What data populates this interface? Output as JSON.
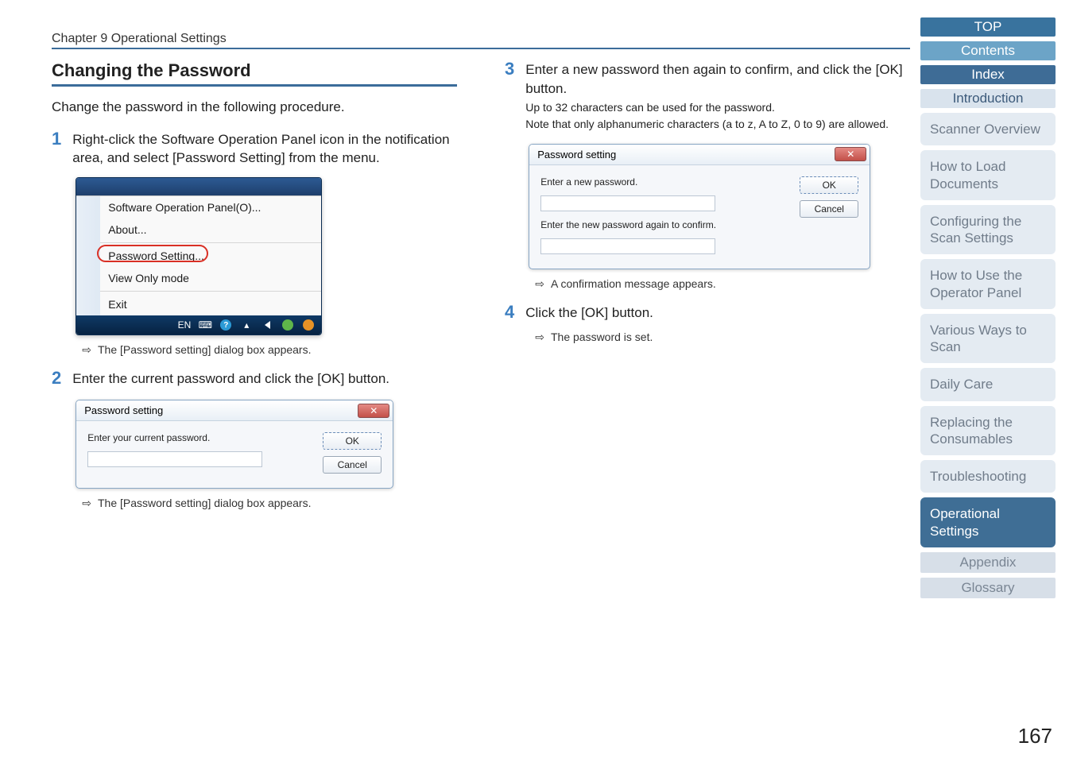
{
  "chapter": "Chapter 9 Operational Settings",
  "page_number": "167",
  "section_title": "Changing the Password",
  "intro_sentence": "Change the password in the following procedure.",
  "steps": [
    {
      "num": "1",
      "text": "Right-click the Software Operation Panel icon in the notification area, and select [Password Setting] from the menu.",
      "result": "The [Password setting] dialog box appears."
    },
    {
      "num": "2",
      "text": "Enter the current password and click the [OK] button.",
      "result": "The [Password setting] dialog box appears."
    },
    {
      "num": "3",
      "text": "Enter a new password then again to confirm, and click the [OK] button.",
      "note1": "Up to 32 characters can be used for the password.",
      "note2": "Note that only alphanumeric characters (a to z, A to Z, 0 to 9) are allowed.",
      "result": "A confirmation message appears."
    },
    {
      "num": "4",
      "text": "Click the [OK] button.",
      "result": "The password is set."
    }
  ],
  "menu": {
    "items": [
      "Software Operation Panel(O)...",
      "About..."
    ],
    "circled": "Password Setting...",
    "after_circled": "View Only mode",
    "exit": "Exit",
    "lang": "EN"
  },
  "dialog1": {
    "title": "Password setting",
    "label": "Enter your current password.",
    "ok": "OK",
    "cancel": "Cancel"
  },
  "dialog2": {
    "title": "Password setting",
    "label1": "Enter a new password.",
    "label2": "Enter the new password again to confirm.",
    "ok": "OK",
    "cancel": "Cancel"
  },
  "sidebar": {
    "top": "TOP",
    "contents": "Contents",
    "index": "Index",
    "intro": "Introduction",
    "items": [
      "Scanner Overview",
      "How to Load Documents",
      "Configuring the Scan Settings",
      "How to Use the Operator Panel",
      "Various Ways to Scan",
      "Daily Care",
      "Replacing the Consumables",
      "Troubleshooting",
      "Operational Settings"
    ],
    "appendix": "Appendix",
    "glossary": "Glossary",
    "active_index": 8
  }
}
